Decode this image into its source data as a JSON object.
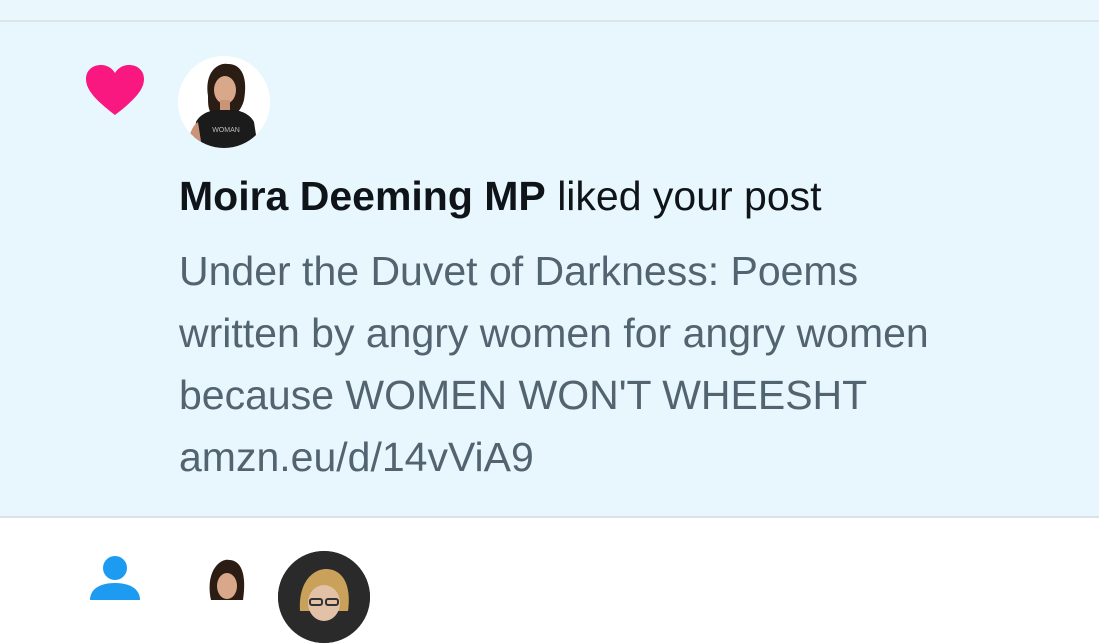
{
  "notification": {
    "icon": "heart-icon",
    "icon_color": "#f91880",
    "actor_name": "Moira Deeming MP",
    "action_text": "liked your post",
    "post_lines": [
      "Under the Duvet of Darkness: Poems",
      "written by angry women for angry women",
      "because WOMEN WON'T WHEESHT",
      "amzn.eu/d/14vViA9"
    ],
    "avatar_shirt_text": "WOMAN"
  },
  "next_notification": {
    "icon": "person-icon",
    "icon_color": "#1d9bf0"
  },
  "colors": {
    "highlight_background": "#e8f6fd",
    "primary_text": "#0f1419",
    "secondary_text": "#536471"
  }
}
